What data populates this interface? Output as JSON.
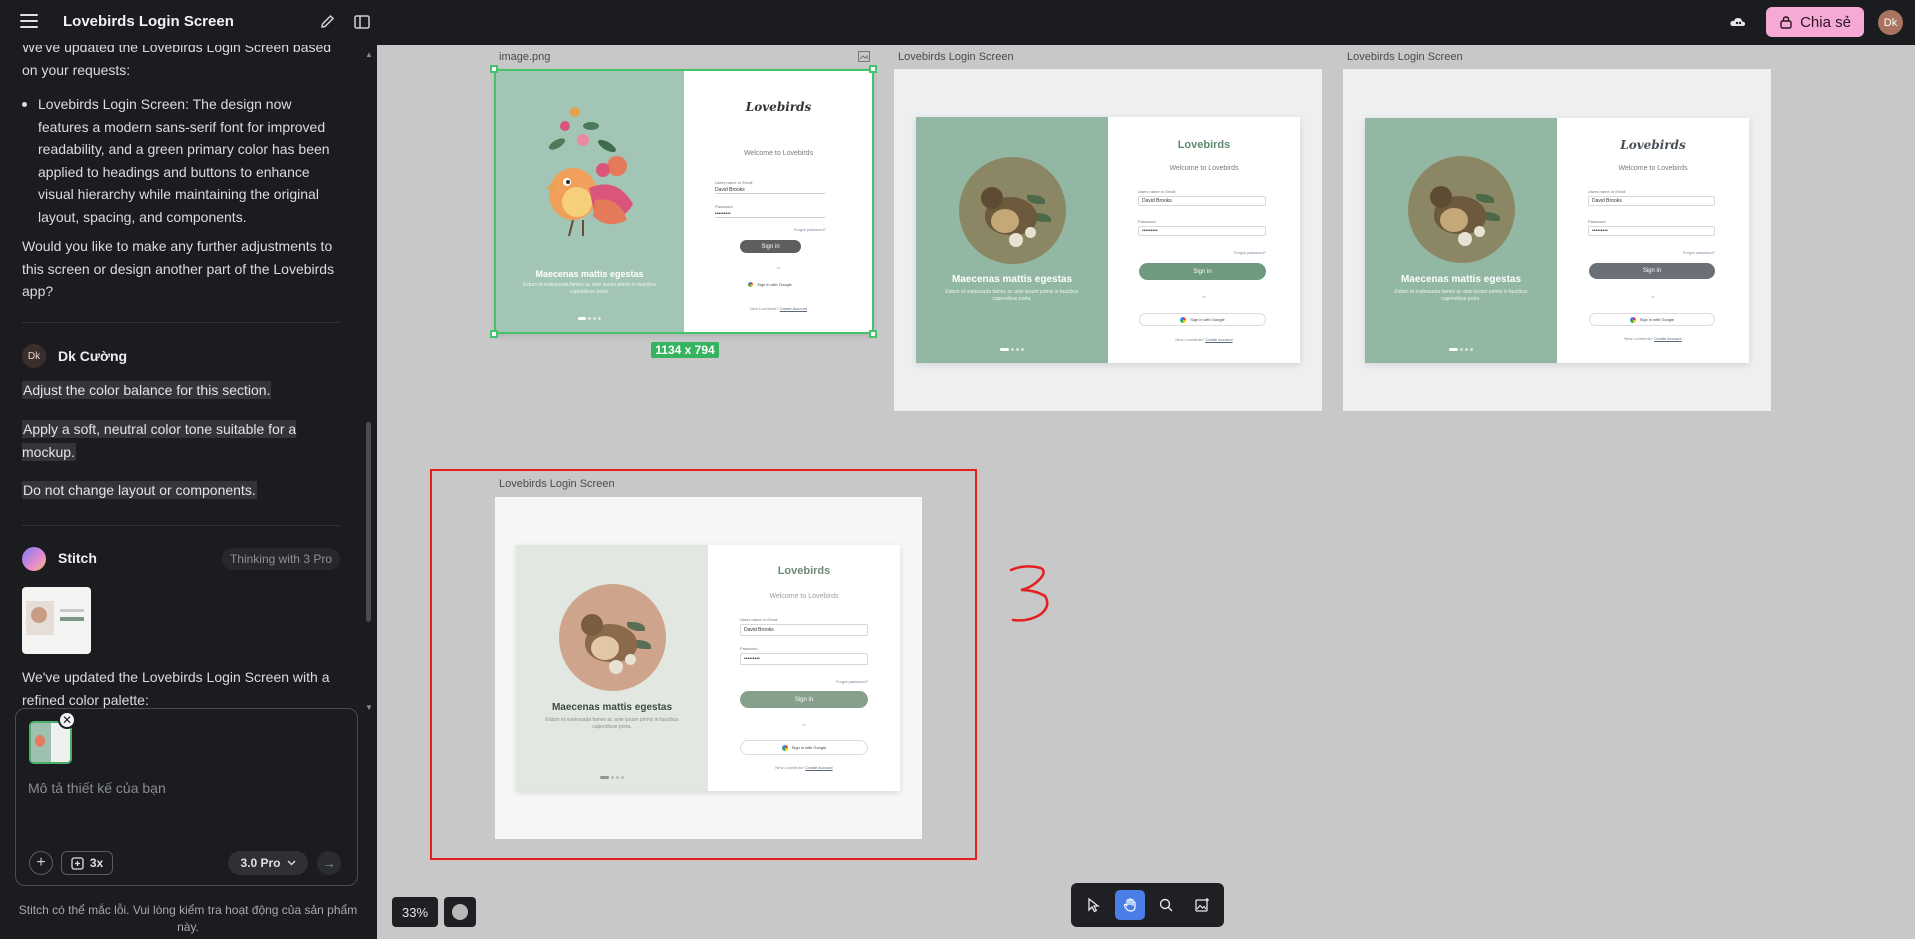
{
  "topbar": {
    "title": "Lovebirds Login Screen",
    "share_label": "Chia sẻ",
    "avatar_initials": "Dk",
    "share_color": "#f7a9d6"
  },
  "chat": {
    "cut_paragraph": "We've updated the Lovebirds Login Screen based on your requests:",
    "bullet": "Lovebirds Login Screen: The design now features a modern sans-serif font for improved readability, and a green primary color has been applied to headings and buttons to enhance visual hierarchy while maintaining the original layout, spacing, and components.",
    "question": "Would you like to make any further adjustments to this screen or design another part of the Lovebirds app?",
    "user_initials": "Dk",
    "user_name": "Dk Cường",
    "user_lines": [
      "Adjust the color balance for this section.",
      "Apply a soft, neutral color tone suitable for a mockup.",
      "Do not change layout or components."
    ],
    "agent_name": "Stitch",
    "thinking_badge": "Thinking with 3 Pro",
    "agent_reply": "We've updated the Lovebirds Login Screen with a refined color palette:"
  },
  "composer": {
    "placeholder": "Mô tả thiết kế của bạn",
    "multiplier": "3x",
    "model": "3.0 Pro"
  },
  "disclaimer": "Stitch có thể mắc lỗi. Vui lòng kiểm tra hoạt động của sản phẩm này.",
  "canvas": {
    "frames": [
      {
        "label": "image.png",
        "size_tag": "1134 x 794",
        "brand": "Lovebirds",
        "welcome": "Welcome to Lovebirds",
        "user_label": "Users name or Email",
        "user_value": "David Brooks",
        "password_label": "Password",
        "password_value": "•••••••••",
        "forgot": "Forgot password?",
        "sign_in": "Sign in",
        "or": "or",
        "google": "Sign in with Google",
        "new_user": "New Lovebirds?",
        "create": "Create Account",
        "hero_title": "Maecenas mattis egestas",
        "hero_text": "Eidum et malesuada fames ac ante ipsum primis in faucibus cupendisse porta.",
        "left_color": "#a3c5b5",
        "button_color": "#5e5e5e"
      },
      {
        "label": "Lovebirds Login Screen",
        "brand": "Lovebirds",
        "welcome": "Welcome to Lovebirds",
        "user_label": "Users name or Email",
        "user_value": "David Brooks",
        "password_label": "Password",
        "password_value": "•••••••••",
        "forgot": "Forgot password?",
        "sign_in": "Sign in",
        "or": "or",
        "google": "Sign in with Google",
        "new_user": "New Lovebirds?",
        "create": "Create Account",
        "hero_title": "Maecenas mattis egestas",
        "hero_text": "Eidum et malesuada fames ac ante ipsum primis in faucibus cupendisse porta.",
        "left_color": "#92b7a3",
        "button_color": "#6f9a80"
      },
      {
        "label": "Lovebirds Login Screen",
        "brand": "Lovebirds",
        "welcome": "Welcome to Lovebirds",
        "user_label": "Users name or Email",
        "user_value": "David Brooks",
        "password_label": "Password",
        "password_value": "•••••••••",
        "forgot": "Forgot password?",
        "sign_in": "Sign in",
        "or": "or",
        "google": "Sign in with Google",
        "new_user": "New Lovebirds?",
        "create": "Create Account",
        "hero_title": "Maecenas mattis egestas",
        "hero_text": "Eidum et malesuada fames ac ante ipsum primis in faucibus cupendisse porta.",
        "left_color": "#92b7a3",
        "button_color": "#6b7076"
      },
      {
        "label": "Lovebirds Login Screen",
        "brand": "Lovebirds",
        "welcome": "Welcome to Lovebirds",
        "user_label": "Users name or Email",
        "user_value": "David Brooks",
        "password_label": "Password",
        "password_value": "•••••••••",
        "forgot": "Forgot password?",
        "sign_in": "Sign in",
        "or": "or",
        "google": "Sign in with Google",
        "new_user": "New Lovebirds?",
        "create": "Create Account",
        "hero_title": "Maecenas mattis egestas",
        "hero_text": "Eidum et malesuada fames ac ante ipsum primis in faucibus cupendisse porta.",
        "left_color": "#e3e7e2",
        "button_color": "#86a08c"
      }
    ],
    "annotation": "3"
  },
  "zoom_level": "33%"
}
